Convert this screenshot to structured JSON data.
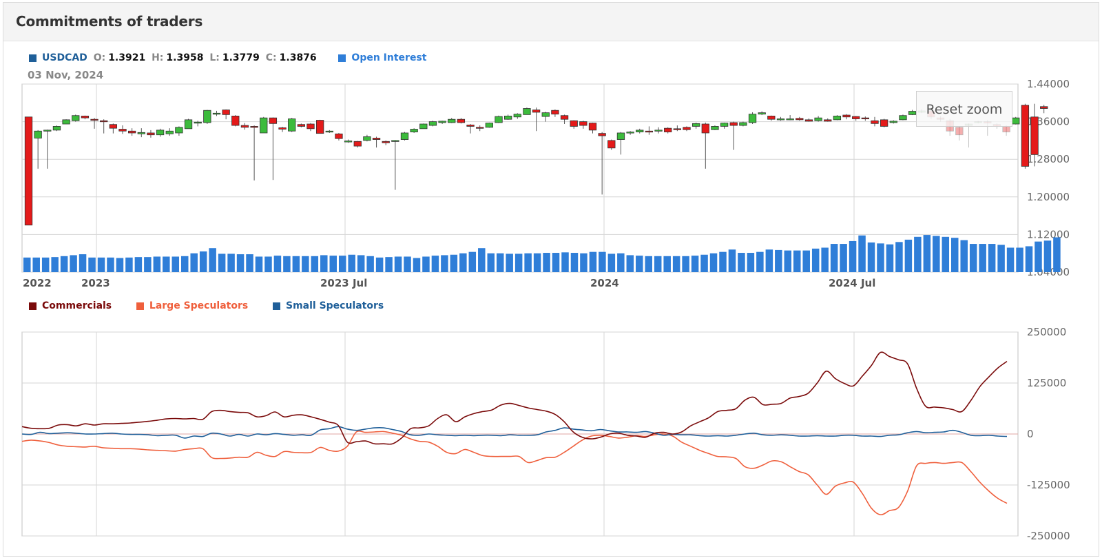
{
  "panel": {
    "title": "Commitments of traders"
  },
  "price_legend": {
    "symbol": "USDCAD",
    "o_key": "O:",
    "o_val": "1.3921",
    "h_key": "H:",
    "h_val": "1.3958",
    "l_key": "L:",
    "l_val": "1.3779",
    "c_key": "C:",
    "c_val": "1.3876",
    "open_interest": "Open Interest",
    "date": "03 Nov, 2024",
    "symbol_color": "#1f5f99",
    "oi_color": "#2f7ed8"
  },
  "reset_zoom": "Reset zoom",
  "positions_legend": {
    "commercials": "Commercials",
    "large": "Large Speculators",
    "small": "Small Speculators",
    "commercials_color": "#7a0a0a",
    "large_color": "#ef5f3c",
    "small_color": "#1f5f99"
  },
  "chart_data": [
    {
      "type": "candlestick",
      "yticks": [
        "1.44000",
        "1.36000",
        "1.28000",
        "1.20000",
        "1.12000",
        "1.04000"
      ],
      "ylim": [
        1.04,
        1.44
      ],
      "x_ticks": [
        "2022",
        "2023",
        "2023 Jul",
        "2024",
        "2024 Jul"
      ],
      "up_color": "#3cbb3c",
      "down_color": "#e41a1a",
      "ohlc": [
        [
          1.37,
          1.35,
          1.14,
          1.14
        ],
        [
          1.325,
          1.342,
          1.26,
          1.34
        ],
        [
          1.342,
          1.343,
          1.26,
          1.342
        ],
        [
          1.342,
          1.352,
          1.34,
          1.35
        ],
        [
          1.355,
          1.365,
          1.355,
          1.364
        ],
        [
          1.362,
          1.375,
          1.36,
          1.373
        ],
        [
          1.372,
          1.373,
          1.365,
          1.368
        ],
        [
          1.365,
          1.368,
          1.345,
          1.364
        ],
        [
          1.362,
          1.365,
          1.335,
          1.36
        ],
        [
          1.354,
          1.356,
          1.335,
          1.346
        ],
        [
          1.344,
          1.352,
          1.334,
          1.34
        ],
        [
          1.34,
          1.346,
          1.33,
          1.336
        ],
        [
          1.334,
          1.346,
          1.327,
          1.337
        ],
        [
          1.336,
          1.342,
          1.326,
          1.332
        ],
        [
          1.332,
          1.345,
          1.328,
          1.342
        ],
        [
          1.334,
          1.346,
          1.33,
          1.34
        ],
        [
          1.336,
          1.35,
          1.33,
          1.348
        ],
        [
          1.345,
          1.366,
          1.345,
          1.364
        ],
        [
          1.358,
          1.362,
          1.35,
          1.359
        ],
        [
          1.358,
          1.385,
          1.355,
          1.384
        ],
        [
          1.378,
          1.383,
          1.372,
          1.378
        ],
        [
          1.385,
          1.386,
          1.365,
          1.375
        ],
        [
          1.372,
          1.374,
          1.35,
          1.352
        ],
        [
          1.352,
          1.357,
          1.343,
          1.348
        ],
        [
          1.35,
          1.352,
          1.235,
          1.348
        ],
        [
          1.336,
          1.37,
          1.336,
          1.368
        ],
        [
          1.368,
          1.369,
          1.236,
          1.356
        ],
        [
          1.347,
          1.349,
          1.338,
          1.344
        ],
        [
          1.34,
          1.368,
          1.338,
          1.366
        ],
        [
          1.354,
          1.356,
          1.348,
          1.35
        ],
        [
          1.355,
          1.357,
          1.34,
          1.345
        ],
        [
          1.363,
          1.364,
          1.335,
          1.335
        ],
        [
          1.339,
          1.342,
          1.336,
          1.34
        ],
        [
          1.334,
          1.336,
          1.32,
          1.324
        ],
        [
          1.318,
          1.322,
          1.315,
          1.319
        ],
        [
          1.318,
          1.319,
          1.305,
          1.308
        ],
        [
          1.32,
          1.332,
          1.318,
          1.328
        ],
        [
          1.325,
          1.328,
          1.305,
          1.322
        ],
        [
          1.318,
          1.32,
          1.31,
          1.315
        ],
        [
          1.318,
          1.321,
          1.215,
          1.32
        ],
        [
          1.322,
          1.338,
          1.32,
          1.336
        ],
        [
          1.338,
          1.346,
          1.336,
          1.344
        ],
        [
          1.345,
          1.356,
          1.345,
          1.355
        ],
        [
          1.352,
          1.362,
          1.35,
          1.36
        ],
        [
          1.358,
          1.362,
          1.355,
          1.361
        ],
        [
          1.358,
          1.368,
          1.357,
          1.365
        ],
        [
          1.365,
          1.368,
          1.356,
          1.358
        ],
        [
          1.353,
          1.355,
          1.335,
          1.35
        ],
        [
          1.348,
          1.352,
          1.34,
          1.346
        ],
        [
          1.348,
          1.358,
          1.347,
          1.357
        ],
        [
          1.358,
          1.373,
          1.357,
          1.371
        ],
        [
          1.365,
          1.375,
          1.364,
          1.372
        ],
        [
          1.37,
          1.378,
          1.366,
          1.376
        ],
        [
          1.375,
          1.39,
          1.375,
          1.388
        ],
        [
          1.385,
          1.39,
          1.34,
          1.38
        ],
        [
          1.371,
          1.381,
          1.36,
          1.379
        ],
        [
          1.384,
          1.386,
          1.37,
          1.376
        ],
        [
          1.373,
          1.375,
          1.355,
          1.365
        ],
        [
          1.362,
          1.363,
          1.345,
          1.35
        ],
        [
          1.36,
          1.362,
          1.345,
          1.352
        ],
        [
          1.357,
          1.358,
          1.335,
          1.342
        ],
        [
          1.335,
          1.338,
          1.205,
          1.33
        ],
        [
          1.32,
          1.322,
          1.3,
          1.304
        ],
        [
          1.322,
          1.338,
          1.29,
          1.336
        ],
        [
          1.336,
          1.34,
          1.332,
          1.338
        ],
        [
          1.338,
          1.345,
          1.335,
          1.342
        ],
        [
          1.34,
          1.35,
          1.332,
          1.338
        ],
        [
          1.34,
          1.348,
          1.335,
          1.342
        ],
        [
          1.346,
          1.348,
          1.335,
          1.338
        ],
        [
          1.345,
          1.352,
          1.34,
          1.344
        ],
        [
          1.348,
          1.35,
          1.34,
          1.343
        ],
        [
          1.35,
          1.358,
          1.345,
          1.356
        ],
        [
          1.355,
          1.358,
          1.26,
          1.336
        ],
        [
          1.343,
          1.352,
          1.342,
          1.35
        ],
        [
          1.35,
          1.358,
          1.345,
          1.357
        ],
        [
          1.358,
          1.36,
          1.3,
          1.352
        ],
        [
          1.352,
          1.36,
          1.35,
          1.358
        ],
        [
          1.358,
          1.38,
          1.355,
          1.376
        ],
        [
          1.376,
          1.382,
          1.374,
          1.379
        ],
        [
          1.372,
          1.373,
          1.362,
          1.365
        ],
        [
          1.365,
          1.37,
          1.362,
          1.366
        ],
        [
          1.365,
          1.374,
          1.363,
          1.366
        ],
        [
          1.367,
          1.37,
          1.362,
          1.364
        ],
        [
          1.364,
          1.367,
          1.36,
          1.361
        ],
        [
          1.362,
          1.372,
          1.36,
          1.368
        ],
        [
          1.364,
          1.367,
          1.36,
          1.361
        ],
        [
          1.364,
          1.374,
          1.363,
          1.372
        ],
        [
          1.374,
          1.376,
          1.365,
          1.37
        ],
        [
          1.371,
          1.372,
          1.362,
          1.366
        ],
        [
          1.368,
          1.371,
          1.362,
          1.366
        ],
        [
          1.362,
          1.37,
          1.35,
          1.356
        ],
        [
          1.364,
          1.366,
          1.348,
          1.35
        ],
        [
          1.358,
          1.363,
          1.356,
          1.361
        ],
        [
          1.364,
          1.375,
          1.363,
          1.373
        ],
        [
          1.375,
          1.385,
          1.374,
          1.382
        ],
        [
          1.38,
          1.387,
          1.378,
          1.383
        ],
        [
          1.383,
          1.395,
          1.365,
          1.37
        ],
        [
          1.368,
          1.372,
          1.36,
          1.365
        ],
        [
          1.362,
          1.366,
          1.33,
          1.34
        ],
        [
          1.348,
          1.35,
          1.32,
          1.332
        ],
        [
          1.352,
          1.356,
          1.305,
          1.355
        ],
        [
          1.358,
          1.362,
          1.356,
          1.36
        ],
        [
          1.36,
          1.364,
          1.33,
          1.357
        ],
        [
          1.354,
          1.357,
          1.345,
          1.35
        ],
        [
          1.35,
          1.352,
          1.33,
          1.338
        ],
        [
          1.355,
          1.37,
          1.354,
          1.368
        ],
        [
          1.395,
          1.398,
          1.26,
          1.265
        ],
        [
          1.37,
          1.398,
          1.265,
          1.29
        ],
        [
          1.392,
          1.396,
          1.378,
          1.388
        ]
      ],
      "open_interest": [
        1.071,
        1.071,
        1.071,
        1.072,
        1.074,
        1.076,
        1.078,
        1.071,
        1.071,
        1.071,
        1.07,
        1.071,
        1.072,
        1.072,
        1.073,
        1.073,
        1.073,
        1.074,
        1.08,
        1.084,
        1.091,
        1.079,
        1.079,
        1.078,
        1.078,
        1.073,
        1.073,
        1.075,
        1.074,
        1.074,
        1.074,
        1.074,
        1.076,
        1.075,
        1.075,
        1.077,
        1.076,
        1.074,
        1.071,
        1.072,
        1.073,
        1.073,
        1.07,
        1.073,
        1.075,
        1.076,
        1.077,
        1.08,
        1.083,
        1.091,
        1.08,
        1.08,
        1.079,
        1.079,
        1.08,
        1.08,
        1.081,
        1.081,
        1.082,
        1.081,
        1.08,
        1.083,
        1.083,
        1.079,
        1.08,
        1.076,
        1.075,
        1.074,
        1.074,
        1.074,
        1.074,
        1.074,
        1.075,
        1.077,
        1.08,
        1.083,
        1.088,
        1.081,
        1.081,
        1.083,
        1.088,
        1.087,
        1.086,
        1.086,
        1.086,
        1.09,
        1.092,
        1.1,
        1.1,
        1.106,
        1.118,
        1.103,
        1.101,
        1.099,
        1.104,
        1.109,
        1.115,
        1.119,
        1.117,
        1.115,
        1.113,
        1.108,
        1.1,
        1.1,
        1.1,
        1.098,
        1.092,
        1.092,
        1.095,
        1.105,
        1.107,
        1.114
      ]
    },
    {
      "type": "line",
      "yticks": [
        "250000",
        "125000",
        "0",
        "-125000",
        "-250000"
      ],
      "ylim": [
        -250000,
        250000
      ],
      "series": [
        {
          "name": "Commercials",
          "color": "#7a0a0a",
          "values": [
            18000,
            14000,
            13000,
            14000,
            22000,
            23000,
            20000,
            25000,
            22000,
            25000,
            25000,
            26000,
            27000,
            29000,
            31000,
            34000,
            37000,
            38000,
            37000,
            38000,
            36000,
            55000,
            58000,
            55000,
            53000,
            52000,
            42000,
            45000,
            54000,
            42000,
            46000,
            47000,
            42000,
            36000,
            29000,
            21000,
            -20000,
            -19000,
            -17000,
            -24000,
            -24000,
            -24000,
            -10000,
            13000,
            15000,
            20000,
            38000,
            47000,
            30000,
            42000,
            50000,
            55000,
            59000,
            71000,
            75000,
            70000,
            64000,
            60000,
            56000,
            48000,
            30000,
            5000,
            -8000,
            -12000,
            -8000,
            0,
            2000,
            -3000,
            -5000,
            -8000,
            2000,
            4000,
            0,
            5000,
            20000,
            30000,
            40000,
            55000,
            58000,
            62000,
            83000,
            90000,
            72000,
            73000,
            75000,
            88000,
            92000,
            100000,
            125000,
            154000,
            136000,
            124000,
            118000,
            142000,
            168000,
            200000,
            190000,
            182000,
            172000,
            112000,
            68000,
            66000,
            64000,
            60000,
            55000,
            82000,
            116000,
            140000,
            162000,
            178000
          ]
        },
        {
          "name": "Large Speculators",
          "color": "#ef5f3c",
          "values": [
            -18000,
            -15000,
            -17000,
            -21000,
            -27000,
            -30000,
            -31000,
            -32000,
            -30000,
            -34000,
            -35000,
            -36000,
            -36000,
            -37000,
            -39000,
            -40000,
            -41000,
            -42000,
            -38000,
            -36000,
            -36000,
            -58000,
            -60000,
            -59000,
            -57000,
            -57000,
            -45000,
            -52000,
            -55000,
            -43000,
            -45000,
            -46000,
            -45000,
            -33000,
            -40000,
            -42000,
            -30000,
            5000,
            4000,
            5000,
            6000,
            2000,
            -3000,
            -12000,
            -18000,
            -20000,
            -30000,
            -45000,
            -48000,
            -38000,
            -45000,
            -53000,
            -55000,
            -55000,
            -55000,
            -55000,
            -70000,
            -65000,
            -58000,
            -57000,
            -45000,
            -30000,
            -15000,
            -5000,
            -3000,
            -6000,
            -10000,
            -8000,
            -4000,
            -6000,
            -2000,
            0,
            -5000,
            -20000,
            -30000,
            -40000,
            -48000,
            -55000,
            -56000,
            -60000,
            -80000,
            -84000,
            -76000,
            -66000,
            -68000,
            -80000,
            -92000,
            -100000,
            -125000,
            -148000,
            -128000,
            -120000,
            -118000,
            -146000,
            -182000,
            -198000,
            -188000,
            -180000,
            -140000,
            -78000,
            -72000,
            -70000,
            -72000,
            -70000,
            -70000,
            -92000,
            -118000,
            -140000,
            -158000,
            -170000
          ]
        },
        {
          "name": "Small Speculators",
          "color": "#1f5f99",
          "values": [
            0,
            -1000,
            4000,
            1000,
            2000,
            3000,
            2000,
            0,
            0,
            1000,
            2000,
            0,
            -1000,
            -1000,
            -2000,
            -4000,
            -3000,
            -3000,
            -10000,
            -5000,
            -6000,
            2000,
            0,
            -5000,
            -1000,
            -5000,
            0,
            -2000,
            1000,
            -1000,
            -3000,
            -2000,
            -3000,
            10000,
            13000,
            18000,
            12000,
            9000,
            12000,
            15000,
            15000,
            11000,
            6000,
            -2000,
            -3000,
            0,
            -2000,
            -3000,
            -4000,
            -3000,
            -4000,
            -3000,
            -3000,
            -4000,
            -2000,
            -3000,
            -3000,
            -2000,
            5000,
            9000,
            15000,
            12000,
            10000,
            8000,
            11000,
            8000,
            5000,
            5000,
            4000,
            6000,
            2000,
            -3000,
            -1000,
            -2000,
            -2000,
            -4000,
            -5000,
            -4000,
            -5000,
            -3000,
            0,
            2000,
            -2000,
            -3000,
            -2000,
            -3000,
            -5000,
            -5000,
            -4000,
            -5000,
            -5000,
            -3000,
            -3000,
            -5000,
            -5000,
            -6000,
            -3000,
            -2000,
            3000,
            6000,
            3000,
            4000,
            5000,
            9000,
            4000,
            -3000,
            -4000,
            -3000,
            -5000,
            -6000
          ]
        }
      ]
    }
  ]
}
